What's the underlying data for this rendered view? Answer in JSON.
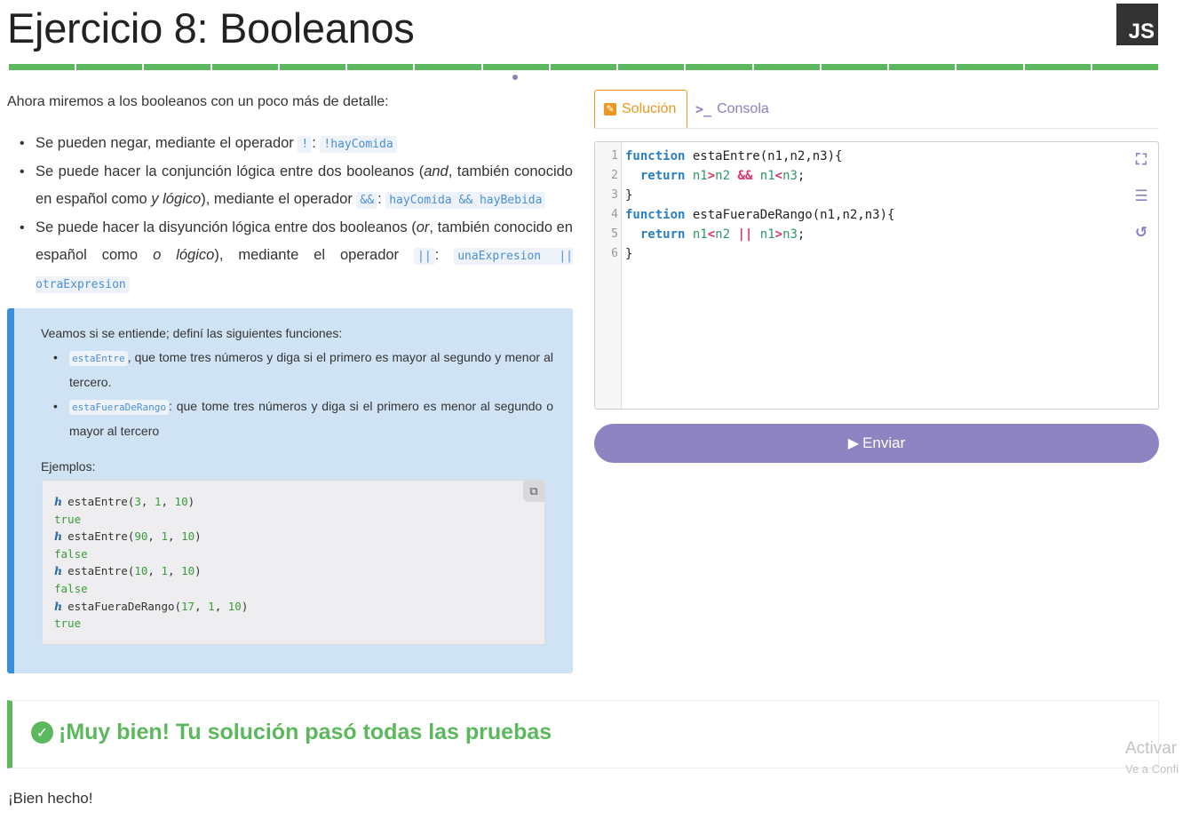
{
  "header": {
    "title": "Ejercicio 8: Booleanos",
    "badge": "JS"
  },
  "progress": {
    "segments": 17,
    "color": "#5cb85c"
  },
  "content": {
    "intro": "Ahora miremos a los booleanos con un poco más de detalle:",
    "bullets": [
      {
        "parts": [
          {
            "t": "text",
            "v": "Se pueden negar, mediante el operador "
          },
          {
            "t": "code",
            "v": "!"
          },
          {
            "t": "text",
            "v": ": "
          },
          {
            "t": "code",
            "v": "!hayComida"
          }
        ]
      },
      {
        "parts": [
          {
            "t": "text",
            "v": "Se puede hacer la conjunción lógica entre dos booleanos ("
          },
          {
            "t": "em",
            "v": "and"
          },
          {
            "t": "text",
            "v": ", también conocido en español como "
          },
          {
            "t": "em",
            "v": "y lógico"
          },
          {
            "t": "text",
            "v": "), mediante el operador "
          },
          {
            "t": "code",
            "v": "&&"
          },
          {
            "t": "text",
            "v": ": "
          },
          {
            "t": "code",
            "v": "hayComida && hayBebida"
          }
        ]
      },
      {
        "parts": [
          {
            "t": "text",
            "v": "Se puede hacer la disyunción lógica entre dos booleanos ("
          },
          {
            "t": "em",
            "v": "or"
          },
          {
            "t": "text",
            "v": ", también conocido en español como "
          },
          {
            "t": "em",
            "v": "o lógico"
          },
          {
            "t": "text",
            "v": "), mediante el operador "
          },
          {
            "t": "code",
            "v": "||"
          },
          {
            "t": "text",
            "v": ": "
          },
          {
            "t": "code",
            "v": "unaExpresion || otraExpresion"
          }
        ]
      }
    ]
  },
  "task": {
    "intro": "Veamos si se entiende; definí las siguientes funciones:",
    "items": [
      {
        "code": "estaEntre",
        "text": ", que tome tres números y diga si el primero es mayor al segundo y menor al tercero."
      },
      {
        "code": "estaFueraDeRango",
        "text": ": que tome tres números y diga si el primero es menor al segundo o mayor al tercero"
      }
    ],
    "examples_label": "Ejemplos:",
    "examples": [
      {
        "call": "estaEntre(",
        "args": [
          "3",
          "1",
          "10"
        ],
        "result": "true"
      },
      {
        "call": "estaEntre(",
        "args": [
          "90",
          "1",
          "10"
        ],
        "result": "false"
      },
      {
        "call": "estaEntre(",
        "args": [
          "10",
          "1",
          "10"
        ],
        "result": "false"
      },
      {
        "call": "estaFueraDeRango(",
        "args": [
          "17",
          "1",
          "10"
        ],
        "result": "true"
      }
    ]
  },
  "tabs": {
    "solution": "Solución",
    "console": "Consola"
  },
  "editor": {
    "line_numbers": [
      "1",
      "2",
      "3",
      "4",
      "5",
      "6"
    ],
    "lines": [
      [
        {
          "c": "kw",
          "v": "function"
        },
        {
          "c": "",
          "v": " estaEntre(n1,n2,n3){"
        }
      ],
      [
        {
          "c": "",
          "v": "  "
        },
        {
          "c": "kw",
          "v": "return"
        },
        {
          "c": "",
          "v": " "
        },
        {
          "c": "var",
          "v": "n1"
        },
        {
          "c": "op",
          "v": ">"
        },
        {
          "c": "var",
          "v": "n2"
        },
        {
          "c": "",
          "v": " "
        },
        {
          "c": "op",
          "v": "&&"
        },
        {
          "c": "",
          "v": " "
        },
        {
          "c": "var",
          "v": "n1"
        },
        {
          "c": "op",
          "v": "<"
        },
        {
          "c": "var",
          "v": "n3"
        },
        {
          "c": "",
          "v": ";"
        }
      ],
      [
        {
          "c": "",
          "v": "}"
        }
      ],
      [
        {
          "c": "kw",
          "v": "function"
        },
        {
          "c": "",
          "v": " estaFueraDeRango(n1,n2,n3){"
        }
      ],
      [
        {
          "c": "",
          "v": "  "
        },
        {
          "c": "kw",
          "v": "return"
        },
        {
          "c": "",
          "v": " "
        },
        {
          "c": "var",
          "v": "n1"
        },
        {
          "c": "op",
          "v": "<"
        },
        {
          "c": "var",
          "v": "n2"
        },
        {
          "c": "",
          "v": " "
        },
        {
          "c": "op",
          "v": "||"
        },
        {
          "c": "",
          "v": " "
        },
        {
          "c": "var",
          "v": "n1"
        },
        {
          "c": "op",
          "v": ">"
        },
        {
          "c": "var",
          "v": "n3"
        },
        {
          "c": "",
          "v": ";"
        }
      ],
      [
        {
          "c": "",
          "v": "}"
        }
      ]
    ]
  },
  "submit": {
    "label": "Enviar"
  },
  "result": {
    "message": "¡Muy bien! Tu solución pasó todas las pruebas"
  },
  "footer": {
    "text": "¡Bien hecho!"
  },
  "watermark": {
    "line1": "Activar",
    "line2": "Ve a Confi"
  },
  "colors": {
    "accent": "#8f84c2",
    "success": "#5cb85c",
    "tab_active": "#ec971f",
    "info_border": "#3a8fd9"
  }
}
